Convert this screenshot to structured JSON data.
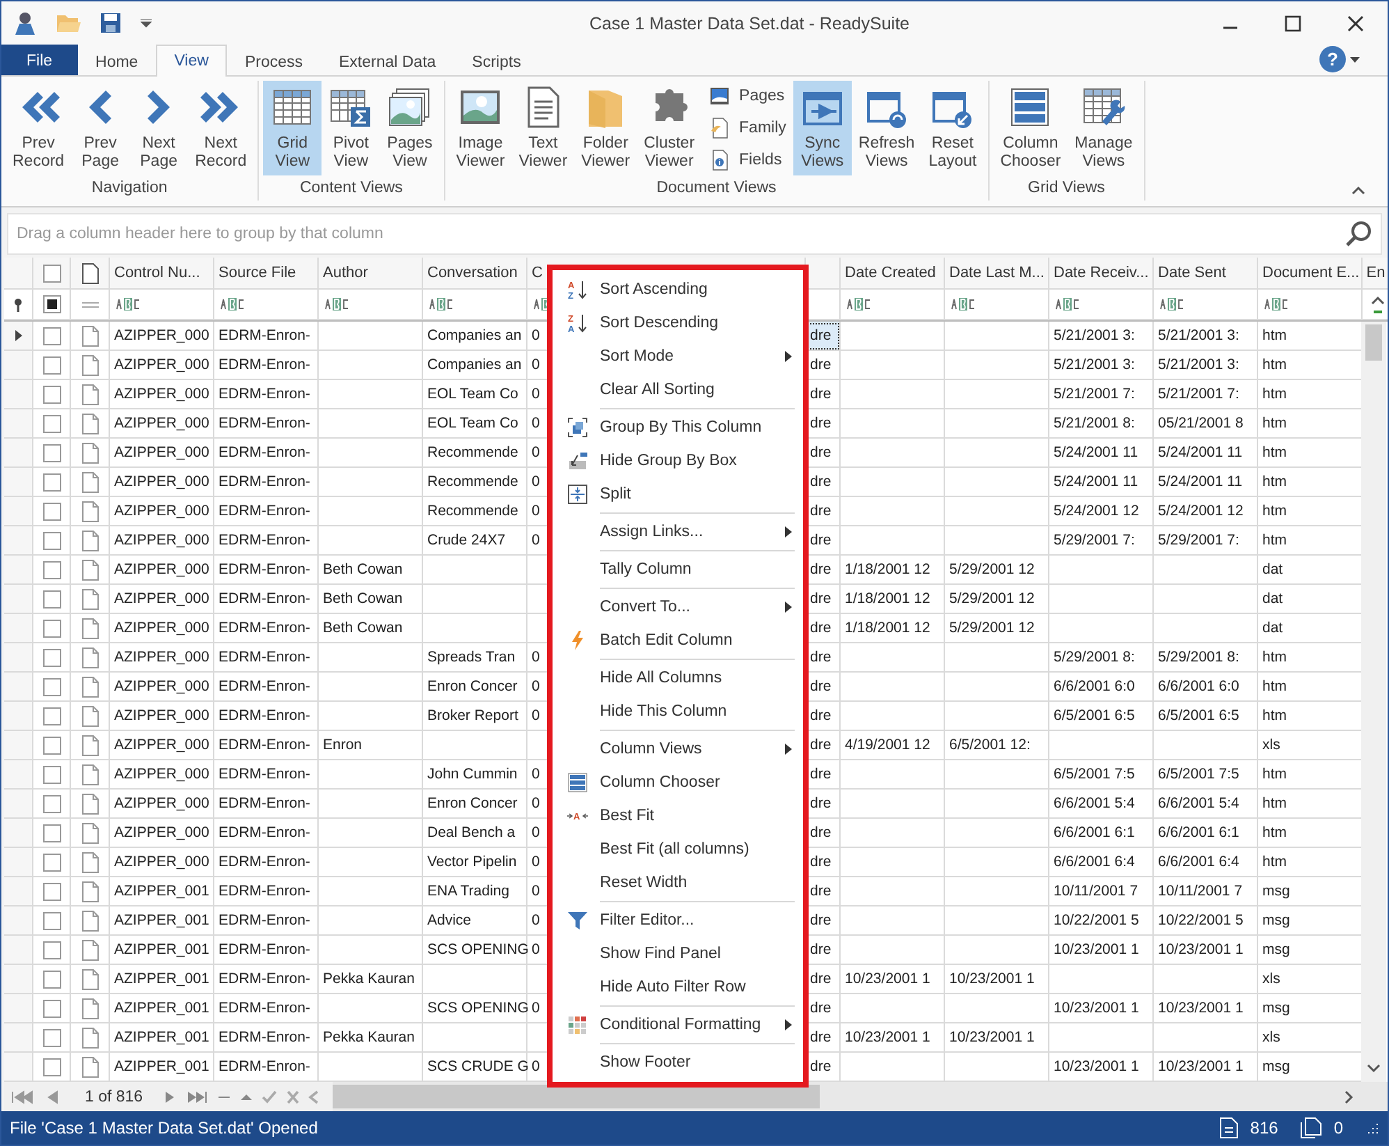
{
  "window": {
    "title": "Case 1 Master Data Set.dat - ReadySuite"
  },
  "tabs": [
    {
      "label": "File",
      "kind": "file",
      "selected": false
    },
    {
      "label": "Home",
      "kind": "tab",
      "selected": false
    },
    {
      "label": "View",
      "kind": "tab",
      "selected": true
    },
    {
      "label": "Process",
      "kind": "tab",
      "selected": false
    },
    {
      "label": "External Data",
      "kind": "tab",
      "selected": false
    },
    {
      "label": "Scripts",
      "kind": "tab",
      "selected": false
    }
  ],
  "ribbon": {
    "groups": [
      {
        "label": "Navigation",
        "buttons": [
          {
            "label": "Prev Record",
            "kind": "large",
            "selected": false
          },
          {
            "label": "Prev Page",
            "kind": "large",
            "selected": false
          },
          {
            "label": "Next Page",
            "kind": "large",
            "selected": false
          },
          {
            "label": "Next Record",
            "kind": "large",
            "selected": false
          }
        ]
      },
      {
        "label": "Content Views",
        "buttons": [
          {
            "label": "Grid View",
            "kind": "large",
            "selected": true
          },
          {
            "label": "Pivot View",
            "kind": "large",
            "selected": false
          },
          {
            "label": "Pages View",
            "kind": "large",
            "selected": false
          }
        ]
      },
      {
        "label": "Document Views",
        "buttons": [
          {
            "label": "Image Viewer",
            "kind": "large",
            "selected": false
          },
          {
            "label": "Text Viewer",
            "kind": "large",
            "selected": false
          },
          {
            "label": "Folder Viewer",
            "kind": "large",
            "selected": false
          },
          {
            "label": "Cluster Viewer",
            "kind": "large",
            "selected": false
          },
          {
            "label": "Pages",
            "kind": "small",
            "selected": false
          },
          {
            "label": "Family",
            "kind": "small",
            "selected": false
          },
          {
            "label": "Fields",
            "kind": "small",
            "selected": false
          },
          {
            "label": "Sync Views",
            "kind": "large",
            "selected": true
          },
          {
            "label": "Refresh Views",
            "kind": "large",
            "selected": false
          },
          {
            "label": "Reset Layout",
            "kind": "large",
            "selected": false
          }
        ]
      },
      {
        "label": "Grid Views",
        "buttons": [
          {
            "label": "Column Chooser",
            "kind": "large",
            "selected": false
          },
          {
            "label": "Manage Views",
            "kind": "large",
            "selected": false
          }
        ]
      }
    ]
  },
  "help": {
    "label": "?"
  },
  "group_panel": {
    "placeholder": "Drag a column header here to group by that column"
  },
  "grid": {
    "select_all_checked": false,
    "filter_checkbox_filled": true,
    "columns": [
      {
        "header": "Control Nu..."
      },
      {
        "header": "Source File"
      },
      {
        "header": "Author"
      },
      {
        "header": "Conversation"
      },
      {
        "header": "C"
      },
      {},
      {
        "header": "Date Created"
      },
      {
        "header": "Date Last M..."
      },
      {
        "header": "Date Receiv..."
      },
      {
        "header": "Date Sent"
      },
      {
        "header": "Document E..."
      },
      {
        "header": "En"
      }
    ],
    "rows": [
      {
        "current": true,
        "checked": false,
        "cells": [
          "AZIPPER_000",
          "EDRM-Enron-",
          "",
          "Companies an",
          "0",
          "dre",
          "",
          "",
          "5/21/2001 3:",
          "5/21/2001 3:",
          "htm"
        ]
      },
      {
        "current": false,
        "checked": false,
        "cells": [
          "AZIPPER_000",
          "EDRM-Enron-",
          "",
          "Companies an",
          "0",
          "dre",
          "",
          "",
          "5/21/2001 3:",
          "5/21/2001 3:",
          "htm"
        ]
      },
      {
        "current": false,
        "checked": false,
        "cells": [
          "AZIPPER_000",
          "EDRM-Enron-",
          "",
          "EOL Team Co",
          "0",
          "dre",
          "",
          "",
          "5/21/2001 7:",
          "5/21/2001 7:",
          "htm"
        ]
      },
      {
        "current": false,
        "checked": false,
        "cells": [
          "AZIPPER_000",
          "EDRM-Enron-",
          "",
          "EOL Team Co",
          "0",
          "dre",
          "",
          "",
          "5/21/2001 8:",
          "05/21/2001 8",
          "htm"
        ]
      },
      {
        "current": false,
        "checked": false,
        "cells": [
          "AZIPPER_000",
          "EDRM-Enron-",
          "",
          "Recommende",
          "0",
          "dre",
          "",
          "",
          "5/24/2001 11",
          "5/24/2001 11",
          "htm"
        ]
      },
      {
        "current": false,
        "checked": false,
        "cells": [
          "AZIPPER_000",
          "EDRM-Enron-",
          "",
          "Recommende",
          "0",
          "dre",
          "",
          "",
          "5/24/2001 11",
          "5/24/2001 11",
          "htm"
        ]
      },
      {
        "current": false,
        "checked": false,
        "cells": [
          "AZIPPER_000",
          "EDRM-Enron-",
          "",
          "Recommende",
          "0",
          "dre",
          "",
          "",
          "5/24/2001 12",
          "5/24/2001 12",
          "htm"
        ]
      },
      {
        "current": false,
        "checked": false,
        "cells": [
          "AZIPPER_000",
          "EDRM-Enron-",
          "",
          "Crude 24X7",
          "0",
          "dre",
          "",
          "",
          "5/29/2001 7:",
          "5/29/2001 7:",
          "htm"
        ]
      },
      {
        "current": false,
        "checked": false,
        "cells": [
          "AZIPPER_000",
          "EDRM-Enron-",
          "Beth Cowan",
          "",
          "",
          "dre",
          "1/18/2001 12",
          "5/29/2001 12",
          "",
          "",
          "dat"
        ]
      },
      {
        "current": false,
        "checked": false,
        "cells": [
          "AZIPPER_000",
          "EDRM-Enron-",
          "Beth Cowan",
          "",
          "",
          "dre",
          "1/18/2001 12",
          "5/29/2001 12",
          "",
          "",
          "dat"
        ]
      },
      {
        "current": false,
        "checked": false,
        "cells": [
          "AZIPPER_000",
          "EDRM-Enron-",
          "Beth Cowan",
          "",
          "",
          "dre",
          "1/18/2001 12",
          "5/29/2001 12",
          "",
          "",
          "dat"
        ]
      },
      {
        "current": false,
        "checked": false,
        "cells": [
          "AZIPPER_000",
          "EDRM-Enron-",
          "",
          "Spreads Tran",
          "0",
          "dre",
          "",
          "",
          "5/29/2001 8:",
          "5/29/2001 8:",
          "htm"
        ]
      },
      {
        "current": false,
        "checked": false,
        "cells": [
          "AZIPPER_000",
          "EDRM-Enron-",
          "",
          "Enron Concer",
          "0",
          "dre",
          "",
          "",
          "6/6/2001 6:0",
          "6/6/2001 6:0",
          "htm"
        ]
      },
      {
        "current": false,
        "checked": false,
        "cells": [
          "AZIPPER_000",
          "EDRM-Enron-",
          "",
          "Broker Report",
          "0",
          "dre",
          "",
          "",
          "6/5/2001 6:5",
          "6/5/2001 6:5",
          "htm"
        ]
      },
      {
        "current": false,
        "checked": false,
        "cells": [
          "AZIPPER_000",
          "EDRM-Enron-",
          "Enron",
          "",
          "",
          "dre",
          "4/19/2001 12",
          "6/5/2001 12:",
          "",
          "",
          "xls"
        ]
      },
      {
        "current": false,
        "checked": false,
        "cells": [
          "AZIPPER_000",
          "EDRM-Enron-",
          "",
          "John Cummin",
          "0",
          "dre",
          "",
          "",
          "6/5/2001 7:5",
          "6/5/2001 7:5",
          "htm"
        ]
      },
      {
        "current": false,
        "checked": false,
        "cells": [
          "AZIPPER_000",
          "EDRM-Enron-",
          "",
          "Enron Concer",
          "0",
          "dre",
          "",
          "",
          "6/6/2001 5:4",
          "6/6/2001 5:4",
          "htm"
        ]
      },
      {
        "current": false,
        "checked": false,
        "cells": [
          "AZIPPER_000",
          "EDRM-Enron-",
          "",
          "Deal Bench a",
          "0",
          "dre",
          "",
          "",
          "6/6/2001 6:1",
          "6/6/2001 6:1",
          "htm"
        ]
      },
      {
        "current": false,
        "checked": false,
        "cells": [
          "AZIPPER_000",
          "EDRM-Enron-",
          "",
          "Vector Pipelin",
          "0",
          "dre",
          "",
          "",
          "6/6/2001 6:4",
          "6/6/2001 6:4",
          "htm"
        ]
      },
      {
        "current": false,
        "checked": false,
        "cells": [
          "AZIPPER_001",
          "EDRM-Enron-",
          "",
          "ENA Trading",
          "0",
          "dre",
          "",
          "",
          "10/11/2001 7",
          "10/11/2001 7",
          "msg"
        ]
      },
      {
        "current": false,
        "checked": false,
        "cells": [
          "AZIPPER_001",
          "EDRM-Enron-",
          "",
          "Advice",
          "0",
          "dre",
          "",
          "",
          "10/22/2001 5",
          "10/22/2001 5",
          "msg"
        ]
      },
      {
        "current": false,
        "checked": false,
        "cells": [
          "AZIPPER_001",
          "EDRM-Enron-",
          "",
          "SCS OPENING",
          "0",
          "dre",
          "",
          "",
          "10/23/2001 1",
          "10/23/2001 1",
          "msg"
        ]
      },
      {
        "current": false,
        "checked": false,
        "cells": [
          "AZIPPER_001",
          "EDRM-Enron-",
          "Pekka Kauran",
          "",
          "",
          "dre",
          "10/23/2001 1",
          "10/23/2001 1",
          "",
          "",
          "xls"
        ]
      },
      {
        "current": false,
        "checked": false,
        "cells": [
          "AZIPPER_001",
          "EDRM-Enron-",
          "",
          "SCS OPENING",
          "0",
          "dre",
          "",
          "",
          "10/23/2001 1",
          "10/23/2001 1",
          "msg"
        ]
      },
      {
        "current": false,
        "checked": false,
        "cells": [
          "AZIPPER_001",
          "EDRM-Enron-",
          "Pekka Kauran",
          "",
          "",
          "dre",
          "10/23/2001 1",
          "10/23/2001 1",
          "",
          "",
          "xls"
        ]
      },
      {
        "current": false,
        "checked": false,
        "cells": [
          "AZIPPER_001",
          "EDRM-Enron-",
          "",
          "SCS CRUDE G",
          "0",
          "dre",
          "",
          "",
          "10/23/2001 1",
          "10/23/2001 1",
          "msg"
        ]
      }
    ]
  },
  "navigator": {
    "position": "1 of 816"
  },
  "context_menu": {
    "groups": [
      [
        {
          "label": "Sort Ascending",
          "submenu": false,
          "icon_letters": [
            "A",
            "Z"
          ]
        },
        {
          "label": "Sort Descending",
          "submenu": false,
          "icon_letters": [
            "Z",
            "A"
          ]
        },
        {
          "label": "Sort Mode",
          "submenu": true
        },
        {
          "label": "Clear All Sorting",
          "submenu": false
        }
      ],
      [
        {
          "label": "Group By This Column",
          "submenu": false
        },
        {
          "label": "Hide Group By Box",
          "submenu": false
        },
        {
          "label": "Split",
          "submenu": false
        }
      ],
      [
        {
          "label": "Assign Links...",
          "submenu": true
        }
      ],
      [
        {
          "label": "Tally Column",
          "submenu": false
        }
      ],
      [
        {
          "label": "Convert To...",
          "submenu": true
        },
        {
          "label": "Batch Edit Column",
          "submenu": false
        }
      ],
      [
        {
          "label": "Hide All Columns",
          "submenu": false
        },
        {
          "label": "Hide This Column",
          "submenu": false
        }
      ],
      [
        {
          "label": "Column Views",
          "submenu": true
        },
        {
          "label": "Column Chooser",
          "submenu": false
        },
        {
          "label": "Best Fit",
          "submenu": false,
          "icon_letters": [
            "A"
          ]
        },
        {
          "label": "Best Fit (all columns)",
          "submenu": false
        },
        {
          "label": "Reset Width",
          "submenu": false
        }
      ],
      [
        {
          "label": "Filter Editor...",
          "submenu": false
        },
        {
          "label": "Show Find Panel",
          "submenu": false
        },
        {
          "label": "Hide Auto Filter Row",
          "submenu": false
        }
      ],
      [
        {
          "label": "Conditional Formatting",
          "submenu": true
        }
      ],
      [
        {
          "label": "Show Footer",
          "submenu": false
        }
      ]
    ]
  },
  "status_bar": {
    "message": "File 'Case 1 Master Data Set.dat' Opened",
    "record_count": "816",
    "selected_count": "0"
  }
}
